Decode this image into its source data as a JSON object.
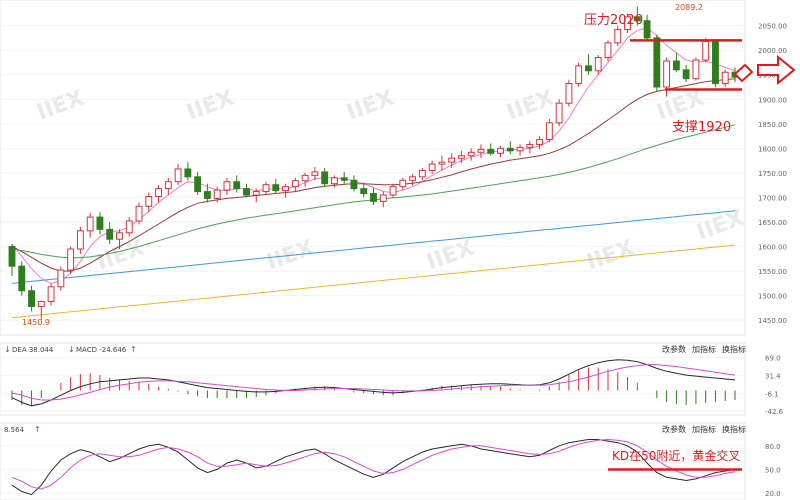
{
  "colors": {
    "up": "#d4343a",
    "down": "#2f7d1f",
    "ma_pink": "#f07ccf",
    "ma_darkred": "#9a3b3b",
    "ma_green": "#4aa25a",
    "ma_blue": "#3b9be0",
    "ma_orange": "#f3b23a",
    "dif": "#2a2a2a",
    "dea": "#d84ad6",
    "annotation": "#d81e1e",
    "axis_text": "#666666",
    "watermark": "#d8d8d8"
  },
  "watermark": "IIEX",
  "price_panel": {
    "y_ticks": [
      "2050.00",
      "2000.00",
      "1950.00",
      "1900.00",
      "1850.00",
      "1800.00",
      "1750.00",
      "1700.00",
      "1650.00",
      "1600.00",
      "1550.00",
      "1500.00",
      "1450.00"
    ],
    "low_label": "1450.9",
    "high_label": "2089.2",
    "annotations": {
      "resistance": "压力2020",
      "support": "支撑1920"
    }
  },
  "macd_panel": {
    "header_left": "DEA 38.044",
    "header_mid": "MACD -24.646",
    "arrow_down": "↓",
    "arrow_up": "↑",
    "buttons": [
      "改参数",
      "加指标",
      "换指标"
    ],
    "y_ticks": [
      "69.0",
      "31.4",
      "-6.1",
      "-42.6"
    ]
  },
  "kd_panel": {
    "header_left": "8.564",
    "arrow_up": "↑",
    "buttons": [
      "改参数",
      "加指标",
      "换指标"
    ],
    "y_ticks": [
      "80.0",
      "50.0",
      "20.0"
    ],
    "annotation": "KD在50附近，黄金交叉"
  },
  "chart_data": {
    "type": "candlestick",
    "ylim": [
      1430,
      2090
    ],
    "levels": {
      "resistance": 2020,
      "support": 1920
    },
    "extremes": {
      "low": 1450.9,
      "high": 2089.2
    },
    "candles": [
      [
        1600,
        1605,
        1540,
        1560
      ],
      [
        1560,
        1570,
        1500,
        1510
      ],
      [
        1510,
        1520,
        1468,
        1478
      ],
      [
        1478,
        1490,
        1450.9,
        1488
      ],
      [
        1488,
        1525,
        1480,
        1518
      ],
      [
        1518,
        1560,
        1510,
        1552
      ],
      [
        1552,
        1600,
        1545,
        1595
      ],
      [
        1595,
        1640,
        1585,
        1632
      ],
      [
        1632,
        1668,
        1618,
        1660
      ],
      [
        1660,
        1670,
        1625,
        1635
      ],
      [
        1635,
        1650,
        1605,
        1615
      ],
      [
        1615,
        1635,
        1595,
        1628
      ],
      [
        1628,
        1660,
        1620,
        1652
      ],
      [
        1652,
        1690,
        1645,
        1682
      ],
      [
        1682,
        1710,
        1670,
        1702
      ],
      [
        1702,
        1725,
        1690,
        1718
      ],
      [
        1718,
        1740,
        1705,
        1732
      ],
      [
        1732,
        1768,
        1725,
        1758
      ],
      [
        1758,
        1772,
        1735,
        1742
      ],
      [
        1742,
        1752,
        1705,
        1712
      ],
      [
        1712,
        1728,
        1690,
        1698
      ],
      [
        1698,
        1722,
        1690,
        1715
      ],
      [
        1715,
        1740,
        1705,
        1732
      ],
      [
        1732,
        1745,
        1710,
        1718
      ],
      [
        1718,
        1728,
        1700,
        1705
      ],
      [
        1705,
        1718,
        1690,
        1712
      ],
      [
        1712,
        1732,
        1705,
        1726
      ],
      [
        1726,
        1738,
        1708,
        1714
      ],
      [
        1714,
        1728,
        1700,
        1722
      ],
      [
        1722,
        1740,
        1712,
        1734
      ],
      [
        1734,
        1750,
        1722,
        1745
      ],
      [
        1745,
        1762,
        1735,
        1752
      ],
      [
        1752,
        1760,
        1722,
        1728
      ],
      [
        1728,
        1745,
        1720,
        1740
      ],
      [
        1740,
        1752,
        1728,
        1735
      ],
      [
        1735,
        1745,
        1712,
        1718
      ],
      [
        1718,
        1730,
        1700,
        1708
      ],
      [
        1708,
        1720,
        1685,
        1692
      ],
      [
        1692,
        1712,
        1680,
        1705
      ],
      [
        1705,
        1728,
        1700,
        1722
      ],
      [
        1722,
        1740,
        1715,
        1735
      ],
      [
        1735,
        1748,
        1725,
        1742
      ],
      [
        1742,
        1760,
        1735,
        1755
      ],
      [
        1755,
        1775,
        1748,
        1768
      ],
      [
        1768,
        1785,
        1755,
        1772
      ],
      [
        1772,
        1790,
        1760,
        1780
      ],
      [
        1780,
        1795,
        1770,
        1785
      ],
      [
        1785,
        1800,
        1775,
        1792
      ],
      [
        1792,
        1808,
        1780,
        1798
      ],
      [
        1798,
        1810,
        1785,
        1790
      ],
      [
        1790,
        1805,
        1782,
        1800
      ],
      [
        1800,
        1815,
        1788,
        1795
      ],
      [
        1795,
        1808,
        1785,
        1802
      ],
      [
        1802,
        1815,
        1790,
        1808
      ],
      [
        1808,
        1825,
        1798,
        1818
      ],
      [
        1818,
        1860,
        1812,
        1852
      ],
      [
        1852,
        1900,
        1845,
        1892
      ],
      [
        1892,
        1940,
        1885,
        1932
      ],
      [
        1932,
        1975,
        1925,
        1968
      ],
      [
        1968,
        1992,
        1950,
        1958
      ],
      [
        1958,
        1990,
        1950,
        1985
      ],
      [
        1985,
        2020,
        1978,
        2015
      ],
      [
        2015,
        2050,
        2008,
        2042
      ],
      [
        2042,
        2075,
        2035,
        2068
      ],
      [
        2068,
        2089.2,
        2050,
        2060
      ],
      [
        2060,
        2072,
        2018,
        2025
      ],
      [
        2025,
        2032,
        1915,
        1925
      ],
      [
        1925,
        1985,
        1905,
        1978
      ],
      [
        1978,
        1995,
        1955,
        1960
      ],
      [
        1960,
        1970,
        1935,
        1942
      ],
      [
        1942,
        1985,
        1938,
        1980
      ],
      [
        1980,
        2025,
        1975,
        2018
      ],
      [
        2018,
        2022,
        1925,
        1932
      ],
      [
        1932,
        1960,
        1925,
        1955
      ],
      [
        1955,
        1965,
        1935,
        1945
      ]
    ],
    "moving_averages": [
      {
        "color_key": "ma_pink",
        "values": [
          1605,
          1580,
          1555,
          1535,
          1525,
          1530,
          1545,
          1570,
          1600,
          1620,
          1630,
          1632,
          1640,
          1655,
          1672,
          1690,
          1705,
          1720,
          1732,
          1730,
          1722,
          1715,
          1714,
          1718,
          1718,
          1714,
          1716,
          1718,
          1718,
          1722,
          1730,
          1738,
          1740,
          1740,
          1738,
          1734,
          1728,
          1720,
          1712,
          1710,
          1715,
          1722,
          1732,
          1745,
          1756,
          1766,
          1775,
          1782,
          1788,
          1792,
          1795,
          1797,
          1798,
          1800,
          1805,
          1815,
          1835,
          1862,
          1895,
          1925,
          1950,
          1975,
          2000,
          2025,
          2040,
          2045,
          2030,
          2010,
          1995,
          1980,
          1975,
          1978,
          1972,
          1965,
          1958
        ]
      },
      {
        "color_key": "ma_darkred",
        "values": [
          1600,
          1590,
          1578,
          1566,
          1556,
          1550,
          1550,
          1556,
          1566,
          1578,
          1590,
          1600,
          1610,
          1622,
          1634,
          1646,
          1658,
          1670,
          1680,
          1688,
          1692,
          1695,
          1698,
          1700,
          1702,
          1704,
          1706,
          1708,
          1710,
          1712,
          1716,
          1720,
          1723,
          1725,
          1727,
          1728,
          1728,
          1727,
          1726,
          1726,
          1727,
          1729,
          1732,
          1736,
          1741,
          1746,
          1752,
          1758,
          1763,
          1768,
          1772,
          1776,
          1779,
          1782,
          1785,
          1790,
          1797,
          1806,
          1818,
          1830,
          1844,
          1858,
          1872,
          1887,
          1900,
          1910,
          1916,
          1920,
          1924,
          1928,
          1932,
          1936,
          1938,
          1940,
          1942
        ]
      },
      {
        "color_key": "ma_green",
        "values": [
          1595,
          1592,
          1588,
          1584,
          1581,
          1578,
          1577,
          1577,
          1579,
          1582,
          1586,
          1590,
          1595,
          1600,
          1606,
          1612,
          1618,
          1624,
          1630,
          1636,
          1641,
          1646,
          1650,
          1654,
          1658,
          1661,
          1664,
          1667,
          1670,
          1673,
          1676,
          1679,
          1682,
          1685,
          1688,
          1691,
          1693,
          1695,
          1697,
          1699,
          1701,
          1703,
          1705,
          1707,
          1710,
          1713,
          1716,
          1719,
          1722,
          1725,
          1728,
          1731,
          1734,
          1737,
          1740,
          1743,
          1747,
          1751,
          1756,
          1761,
          1767,
          1773,
          1779,
          1786,
          1793,
          1800,
          1806,
          1812,
          1818,
          1823,
          1828,
          1833,
          1838,
          1843,
          1848
        ]
      },
      {
        "color_key": "ma_blue",
        "values": [
          1525,
          1527,
          1529,
          1531,
          1533,
          1535,
          1537,
          1539,
          1541,
          1543,
          1545,
          1547,
          1549,
          1551,
          1553,
          1555,
          1557,
          1559,
          1561,
          1563,
          1565,
          1567,
          1569,
          1571,
          1573,
          1575,
          1577,
          1579,
          1581,
          1583,
          1585,
          1587,
          1589,
          1591,
          1593,
          1595,
          1597,
          1599,
          1601,
          1603,
          1605,
          1607,
          1609,
          1611,
          1613,
          1615,
          1617,
          1619,
          1621,
          1623,
          1625,
          1627,
          1629,
          1631,
          1633,
          1635,
          1637,
          1639,
          1641,
          1643,
          1645,
          1647,
          1649,
          1651,
          1653,
          1655,
          1657,
          1659,
          1661,
          1663,
          1665,
          1667,
          1669,
          1671,
          1673
        ]
      },
      {
        "color_key": "ma_orange",
        "values": [
          1455,
          1457,
          1459,
          1461,
          1463,
          1465,
          1467,
          1469,
          1471,
          1473,
          1475,
          1477,
          1479,
          1481,
          1483,
          1485,
          1487,
          1489,
          1491,
          1493,
          1495,
          1497,
          1499,
          1501,
          1503,
          1505,
          1507,
          1509,
          1511,
          1513,
          1515,
          1517,
          1519,
          1521,
          1523,
          1525,
          1527,
          1529,
          1531,
          1533,
          1535,
          1537,
          1539,
          1541,
          1543,
          1545,
          1547,
          1549,
          1551,
          1553,
          1555,
          1557,
          1559,
          1561,
          1563,
          1565,
          1567,
          1569,
          1571,
          1573,
          1575,
          1577,
          1579,
          1581,
          1583,
          1585,
          1587,
          1589,
          1591,
          1593,
          1595,
          1597,
          1599,
          1601,
          1603
        ]
      }
    ],
    "macd": {
      "ylim": [
        -45,
        72
      ],
      "dif": [
        -15,
        -25,
        -32,
        -28,
        -20,
        -10,
        0,
        8,
        14,
        18,
        20,
        22,
        24,
        26,
        26,
        24,
        22,
        18,
        14,
        10,
        6,
        4,
        2,
        0,
        -2,
        -3,
        -3,
        -2,
        0,
        2,
        4,
        6,
        7,
        6,
        4,
        2,
        0,
        -2,
        -4,
        -5,
        -4,
        -2,
        0,
        3,
        6,
        8,
        10,
        12,
        13,
        14,
        14,
        13,
        12,
        11,
        12,
        16,
        24,
        34,
        44,
        52,
        58,
        62,
        64,
        63,
        60,
        54,
        46,
        40,
        36,
        32,
        30,
        28,
        26,
        24,
        22
      ],
      "dea": [
        -5,
        -10,
        -16,
        -20,
        -20,
        -18,
        -14,
        -9,
        -4,
        2,
        7,
        11,
        14,
        17,
        19,
        20,
        20,
        19,
        18,
        16,
        14,
        12,
        10,
        8,
        6,
        4,
        2,
        1,
        0,
        0,
        1,
        2,
        3,
        4,
        4,
        4,
        3,
        2,
        1,
        0,
        -1,
        -1,
        -1,
        0,
        1,
        3,
        5,
        6,
        8,
        9,
        10,
        11,
        11,
        11,
        11,
        12,
        15,
        18,
        23,
        28,
        34,
        40,
        45,
        49,
        52,
        54,
        54,
        52,
        50,
        47,
        44,
        41,
        38,
        35,
        32
      ],
      "hist": [
        -20,
        -30,
        -32,
        -16,
        0,
        16,
        28,
        34,
        36,
        32,
        26,
        22,
        20,
        18,
        14,
        8,
        4,
        -2,
        -8,
        -12,
        -16,
        -16,
        -16,
        -16,
        -16,
        -14,
        -10,
        -6,
        0,
        4,
        6,
        8,
        8,
        4,
        0,
        -4,
        -6,
        -8,
        -10,
        -10,
        -6,
        -2,
        2,
        6,
        10,
        10,
        10,
        12,
        10,
        10,
        8,
        4,
        2,
        0,
        2,
        8,
        18,
        32,
        42,
        48,
        48,
        44,
        38,
        28,
        16,
        0,
        -16,
        -24,
        -28,
        -30,
        -28,
        -26,
        -24,
        -22,
        -20
      ]
    },
    "kd": {
      "ylim": [
        15,
        95
      ],
      "k": [
        30,
        22,
        18,
        30,
        48,
        62,
        70,
        75,
        72,
        66,
        60,
        64,
        70,
        76,
        80,
        82,
        78,
        72,
        62,
        52,
        46,
        50,
        58,
        62,
        58,
        52,
        54,
        60,
        66,
        70,
        74,
        76,
        70,
        62,
        56,
        50,
        44,
        40,
        44,
        52,
        60,
        66,
        72,
        76,
        78,
        80,
        82,
        80,
        76,
        74,
        72,
        70,
        68,
        66,
        68,
        74,
        80,
        84,
        86,
        88,
        88,
        86,
        84,
        80,
        72,
        58,
        46,
        40,
        38,
        36,
        38,
        42,
        46,
        48,
        50
      ],
      "d": [
        40,
        35,
        28,
        25,
        30,
        40,
        52,
        62,
        68,
        70,
        68,
        66,
        66,
        68,
        72,
        76,
        78,
        76,
        72,
        66,
        58,
        54,
        54,
        56,
        58,
        56,
        54,
        55,
        58,
        62,
        66,
        70,
        72,
        70,
        66,
        60,
        54,
        48,
        45,
        46,
        50,
        56,
        62,
        68,
        72,
        76,
        78,
        80,
        80,
        78,
        76,
        74,
        72,
        70,
        69,
        70,
        73,
        78,
        82,
        85,
        87,
        88,
        87,
        85,
        80,
        72,
        62,
        54,
        48,
        43,
        40,
        40,
        42,
        45,
        47
      ]
    }
  }
}
